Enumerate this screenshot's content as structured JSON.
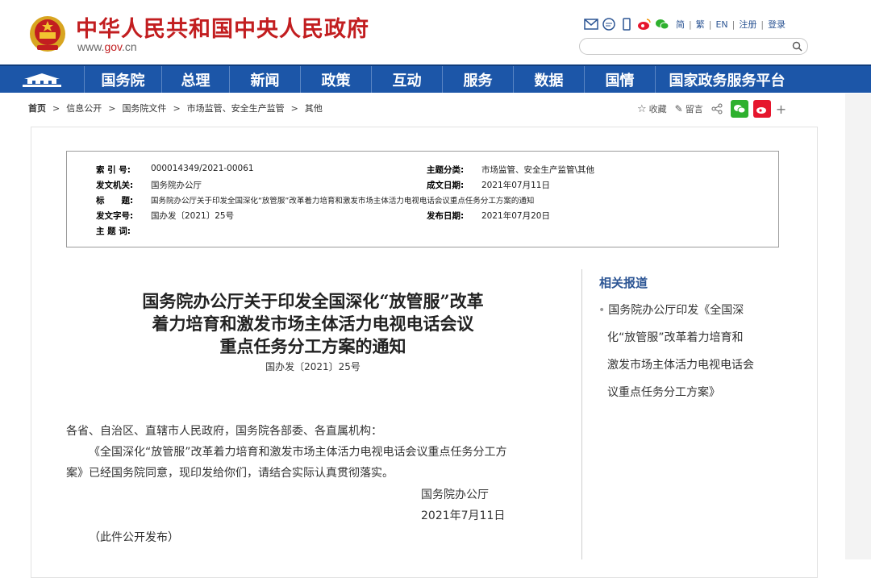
{
  "header": {
    "site_title": "中华人民共和国中央人民政府",
    "site_url_pre": "www.",
    "site_url_mid": "gov",
    "site_url_post": ".cn",
    "links": [
      "简",
      "繁",
      "EN",
      "注册",
      "登录"
    ],
    "search_placeholder": ""
  },
  "nav": {
    "items": [
      "国务院",
      "总理",
      "新闻",
      "政策",
      "互动",
      "服务",
      "数据",
      "国情",
      "国家政务服务平台"
    ]
  },
  "breadcrumb": [
    "首页",
    "信息公开",
    "国务院文件",
    "市场监管、安全生产监管",
    "其他"
  ],
  "share": {
    "collect": "收藏",
    "comment": "留言",
    "plus": "+"
  },
  "meta": {
    "index_label": "索 引 号:",
    "index_value": "000014349/2021-00061",
    "topic_label": "主题分类:",
    "topic_value": "市场监管、安全生产监管\\其他",
    "issuer_label": "发文机关:",
    "issuer_value": "国务院办公厅",
    "date_label": "成文日期:",
    "date_value": "2021年07月11日",
    "title_label": "标　　题:",
    "title_value": "国务院办公厅关于印发全国深化“放管服”改革着力培育和激发市场主体活力电视电话会议重点任务分工方案的通知",
    "docno_label": "发文字号:",
    "docno_value": "国办发〔2021〕25号",
    "pub_label": "发布日期:",
    "pub_value": "2021年07月20日",
    "keywords_label": "主 题 词:"
  },
  "document": {
    "title_line1": "国务院办公厅关于印发全国深化“放管服”改革",
    "title_line2": "着力培育和激发市场主体活力电视电话会议",
    "title_line3": "重点任务分工方案的通知",
    "doc_no": "国办发〔2021〕25号",
    "addressee": "各省、自治区、直辖市人民政府，国务院各部委、各直属机构：",
    "para1_line1": "《全国深化“放管服”改革着力培育和激发市场主体活力电视电话会议重点任务分工方",
    "para1_line2": "案》已经国务院同意，现印发给你们，请结合实际认真贯彻落实。",
    "sign_org": "国务院办公厅",
    "sign_date": "2021年7月11日",
    "note": "（此件公开发布）"
  },
  "sidebar": {
    "title": "相关报道",
    "item_lines": [
      "国务院办公厅印发《全国深",
      "化“放管服”改革着力培育和",
      "激发市场主体活力电视电话会",
      "议重点任务分工方案》"
    ]
  }
}
